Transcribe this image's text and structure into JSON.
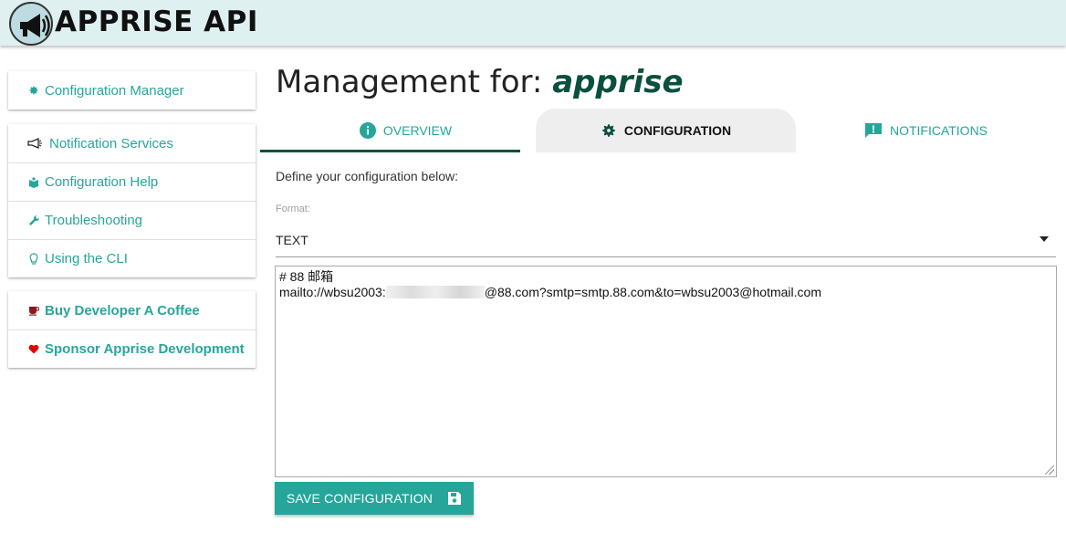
{
  "header": {
    "brand": "APPRISE API",
    "logo_icon": "megaphone-icon"
  },
  "sidebar": {
    "group1": [
      {
        "label": "Configuration Manager",
        "icon": "gear-icon"
      }
    ],
    "group2": [
      {
        "label": "Notification Services",
        "icon": "megaphone-icon"
      },
      {
        "label": "Configuration Help",
        "icon": "book-icon"
      },
      {
        "label": "Troubleshooting",
        "icon": "wrench-icon"
      },
      {
        "label": "Using the CLI",
        "icon": "lightbulb-icon"
      }
    ],
    "group3": [
      {
        "label": "Buy Developer A Coffee",
        "icon": "coffee-icon"
      },
      {
        "label": "Sponsor Apprise Development",
        "icon": "heart-icon"
      }
    ]
  },
  "main": {
    "title_prefix": "Management for:",
    "title_name": "apprise",
    "tabs": [
      {
        "label": "OVERVIEW",
        "icon": "info-icon"
      },
      {
        "label": "CONFIGURATION",
        "icon": "gear-icon"
      },
      {
        "label": "NOTIFICATIONS",
        "icon": "message-alert-icon"
      }
    ],
    "intro": "Define your configuration below:",
    "format_label": "Format:",
    "format_value": "TEXT",
    "config_line1": "# 88 邮箱",
    "config_line2_prefix": "mailto://wbsu2003:",
    "config_line2_suffix": "@88.com?smtp=smtp.88.com&to=wbsu2003@hotmail.com",
    "save_label": "SAVE CONFIGURATION"
  },
  "colors": {
    "accent": "#26a69a",
    "header_bg": "#dff0f0",
    "dark_green": "#0b4f3f"
  }
}
